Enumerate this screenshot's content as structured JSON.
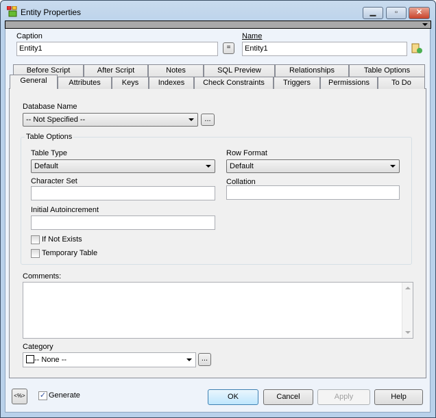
{
  "window": {
    "title": "Entity Properties",
    "minimize": "▁",
    "maximize": "▫",
    "close": "✕"
  },
  "header": {
    "caption_label": "Caption",
    "caption_value": "Entity1",
    "equal_label": "=",
    "name_label": "Name",
    "name_value": "Entity1"
  },
  "tabs_row1": [
    "Before Script",
    "After Script",
    "Notes",
    "SQL Preview",
    "Relationships",
    "Table Options"
  ],
  "tabs_row2": [
    "General",
    "Attributes",
    "Keys",
    "Indexes",
    "Check Constraints",
    "Triggers",
    "Permissions",
    "To Do"
  ],
  "general": {
    "database_name_label": "Database Name",
    "database_name_value": "-- Not Specified --",
    "browse": "...",
    "table_options_label": "Table Options",
    "table_type_label": "Table Type",
    "table_type_value": "Default",
    "row_format_label": "Row Format",
    "row_format_value": "Default",
    "character_set_label": "Character Set",
    "collation_label": "Collation",
    "initial_autoincrement_label": "Initial Autoincrement",
    "if_not_exists_label": "If Not Exists",
    "temporary_table_label": "Temporary Table",
    "comments_label": "Comments:",
    "category_label": "Category",
    "category_value": "-- None --"
  },
  "footer": {
    "macro_label": "<%>",
    "generate_label": "Generate",
    "ok": "OK",
    "cancel": "Cancel",
    "apply": "Apply",
    "help": "Help"
  }
}
